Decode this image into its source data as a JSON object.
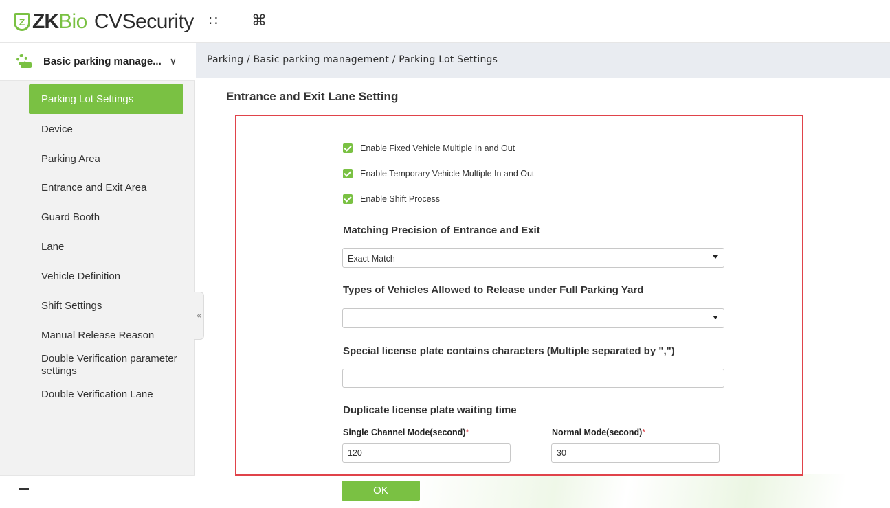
{
  "brand": {
    "logo_mark": "Z",
    "zk": "ZK",
    "bio": "Bio",
    "product": "CVSecurity",
    "accent": "#7ac143"
  },
  "header": {
    "apps_icon": "grid-icon",
    "apps_glyph": "∷",
    "shortcut_icon": "command-icon",
    "shortcut_glyph": "⌘"
  },
  "sidebar": {
    "module_label": "Basic parking manage...",
    "module_chevron": "∨",
    "active_item": "Parking Lot Settings",
    "items": [
      "Device",
      "Parking Area",
      "Entrance and Exit Area",
      "Guard Booth",
      "Lane",
      "Vehicle Definition",
      "Shift Settings",
      "Manual Release Reason",
      "Double Verification parameter settings",
      "Double Verification Lane"
    ],
    "collapse_glyph": "«"
  },
  "breadcrumb": "Parking / Basic parking management / Parking Lot Settings",
  "main": {
    "title": "Entrance and Exit Lane Setting",
    "checkboxes": [
      {
        "label": "Enable Fixed Vehicle Multiple In and Out",
        "checked": true
      },
      {
        "label": "Enable Temporary Vehicle Multiple In and Out",
        "checked": true
      },
      {
        "label": "Enable Shift Process",
        "checked": true
      }
    ],
    "matching_precision": {
      "label": "Matching Precision of Entrance and Exit",
      "value": "Exact Match"
    },
    "vehicle_types": {
      "label": "Types of Vehicles Allowed to Release under Full Parking Yard",
      "value": ""
    },
    "special_plate": {
      "label": "Special license plate contains characters  (Multiple separated by \",\")",
      "value": ""
    },
    "duplicate_wait": {
      "label": "Duplicate license plate waiting time",
      "single_label": "Single Channel Mode(second)",
      "single_value": "120",
      "normal_label": "Normal Mode(second)",
      "normal_value": "30",
      "required_mark": "*"
    },
    "ok_label": "OK"
  }
}
